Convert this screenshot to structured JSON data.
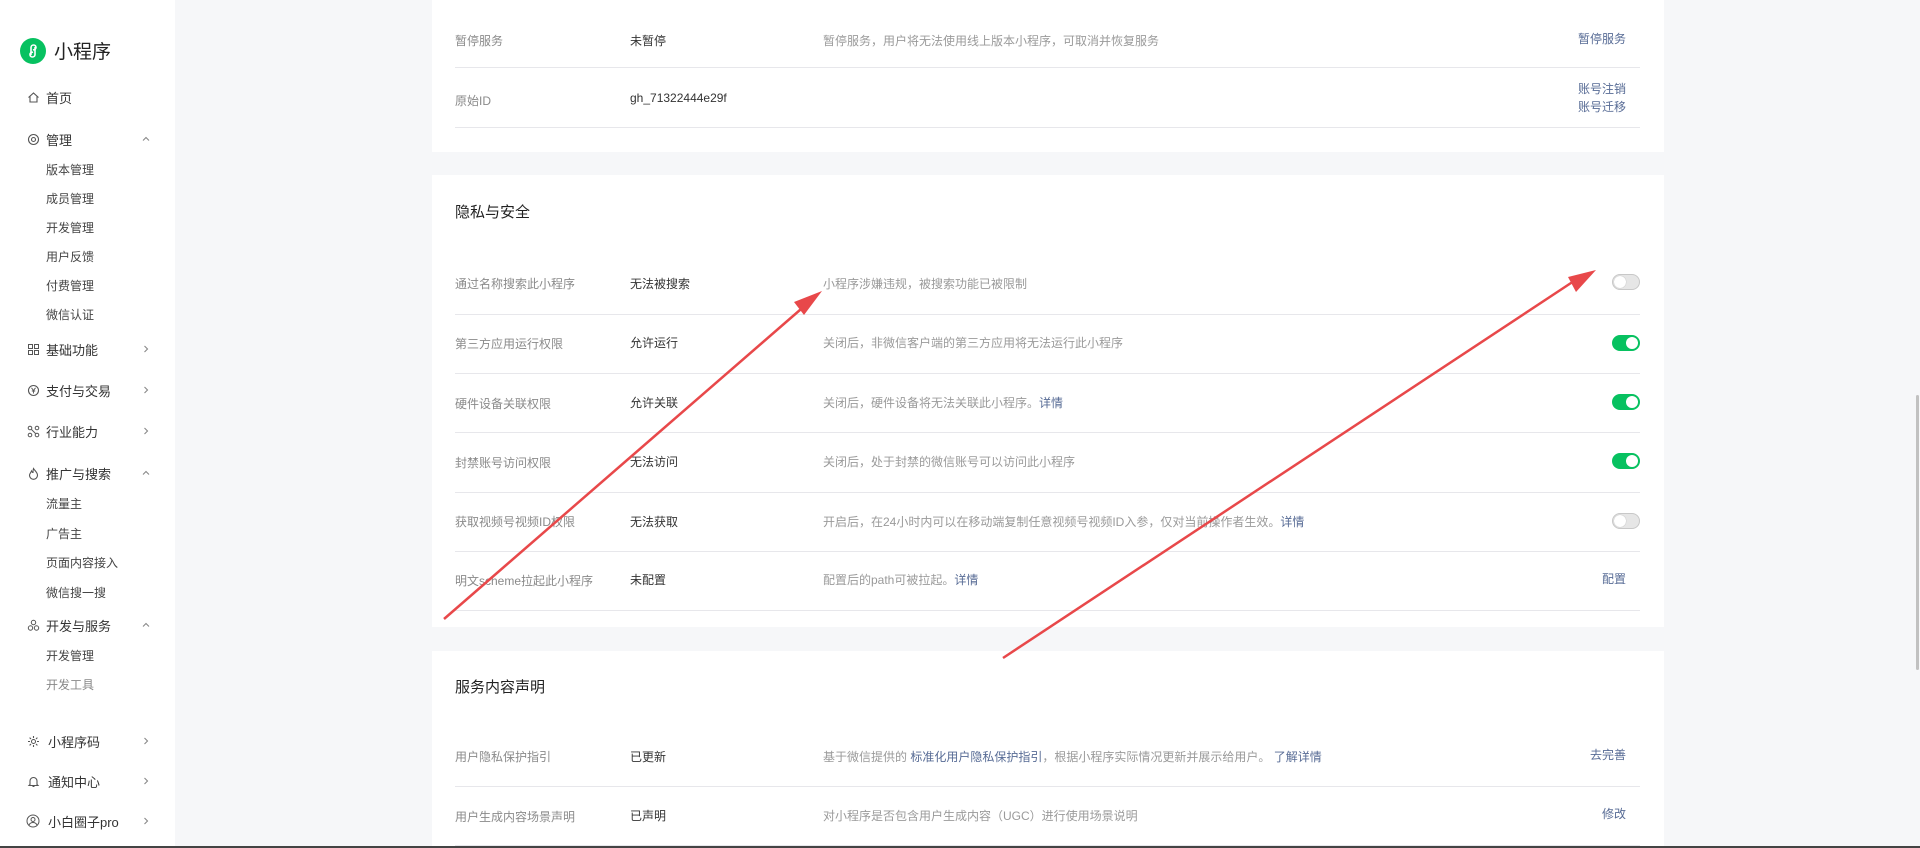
{
  "app": {
    "name": "小程序"
  },
  "sidebar": {
    "home": "首页",
    "manage": {
      "label": "管理",
      "children": [
        "版本管理",
        "成员管理",
        "开发管理",
        "用户反馈",
        "付费管理",
        "微信认证"
      ]
    },
    "basic": "基础功能",
    "pay": "支付与交易",
    "industry": "行业能力",
    "promo": {
      "label": "推广与搜索",
      "children": [
        "流量主",
        "广告主",
        "页面内容接入",
        "微信搜一搜"
      ]
    },
    "dev": {
      "label": "开发与服务",
      "children": [
        "开发管理",
        "开发工具"
      ]
    },
    "qrcode": "小程序码",
    "notify": "通知中心",
    "account": "小白圈子pro"
  },
  "basic_info": {
    "rows": [
      {
        "label": "暂停服务",
        "value": "未暂停",
        "desc": "暂停服务，用户将无法使用线上版本小程序，可取消并恢复服务",
        "action": "暂停服务"
      },
      {
        "label": "原始ID",
        "value": "gh_71322444e29f",
        "desc": "",
        "actions": [
          "账号注销",
          "账号迁移"
        ]
      }
    ]
  },
  "privacy": {
    "title": "隐私与安全",
    "rows": [
      {
        "label": "通过名称搜索此小程序",
        "value": "无法被搜索",
        "desc": "小程序涉嫌违规，被搜索功能已被限制",
        "toggle": "off"
      },
      {
        "label": "第三方应用运行权限",
        "value": "允许运行",
        "desc": "关闭后，非微信客户端的第三方应用将无法运行此小程序",
        "toggle": "on"
      },
      {
        "label": "硬件设备关联权限",
        "value": "允许关联",
        "desc": "关闭后，硬件设备将无法关联此小程序。",
        "link": "详情",
        "toggle": "on"
      },
      {
        "label": "封禁账号访问权限",
        "value": "无法访问",
        "desc": "关闭后，处于封禁的微信账号可以访问此小程序",
        "toggle": "on"
      },
      {
        "label": "获取视频号视频ID权限",
        "value": "无法获取",
        "desc": "开启后，在24小时内可以在移动端复制任意视频号视频ID入参，仅对当前操作者生效。",
        "link": "详情",
        "toggle": "off"
      },
      {
        "label": "明文scheme拉起此小程序",
        "value": "未配置",
        "desc": "配置后的path可被拉起。",
        "link": "详情",
        "action": "配置"
      }
    ]
  },
  "service": {
    "title": "服务内容声明",
    "rows": [
      {
        "label": "用户隐私保护指引",
        "value": "已更新",
        "desc_pre": "基于微信提供的",
        "desc_link1": "标准化用户隐私保护指引",
        "desc_mid": "，根据小程序实际情况更新并展示给用户。",
        "desc_link2": "了解详情",
        "action": "去完善"
      },
      {
        "label": "用户生成内容场景声明",
        "value": "已声明",
        "desc": "对小程序是否包含用户生成内容（UGC）进行使用场景说明",
        "action": "修改"
      }
    ]
  },
  "colors": {
    "accent": "#07c160",
    "link": "#576b95",
    "annotation": "#e8484a"
  }
}
